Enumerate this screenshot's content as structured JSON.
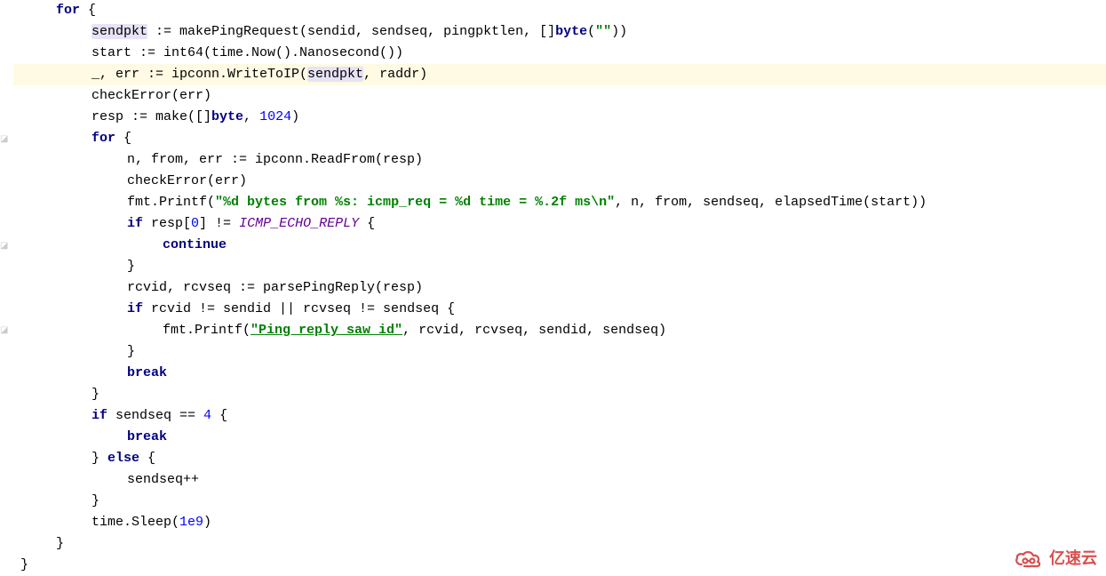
{
  "code": {
    "l1_for": "for",
    "l1_brace": " {",
    "l2_sendpkt": "sendpkt",
    "l2_assign": " := makePingRequest(sendid, sendseq, pingpktlen, []",
    "l2_byte": "byte",
    "l2_paren": "(",
    "l2_str": "\"\"",
    "l2_end": "))",
    "l3_a": "start := int64(time.Now().Nanosecond())",
    "l4_a": "_, err := ipconn.WriteToIP(",
    "l4_sendpkt": "sendpkt",
    "l4_b": ", raddr)",
    "l5": "checkError(err)",
    "l6_a": "resp := make([]",
    "l6_byte": "byte",
    "l6_b": ", ",
    "l6_num": "1024",
    "l6_c": ")",
    "l7_for": "for",
    "l7_brace": " {",
    "l8": "n, from, err := ipconn.ReadFrom(resp)",
    "l9": "checkError(err)",
    "l10_a": "fmt.Printf(",
    "l10_str": "\"%d bytes from %s: icmp_req = %d time = %.2f ms\\n\"",
    "l10_b": ", n, from, sendseq, elapsedTime(start))",
    "l11_if": "if",
    "l11_a": " resp[",
    "l11_num": "0",
    "l11_b": "] != ",
    "l11_const": "ICMP_ECHO_REPLY",
    "l11_c": " {",
    "l12": "continue",
    "l13": "}",
    "l14": "rcvid, rcvseq := parsePingReply(resp)",
    "l15_if": "if",
    "l15_a": " rcvid != sendid || rcvseq != sendseq {",
    "l16_a": "fmt.Printf(",
    "l16_str": "\"Ping reply saw id\"",
    "l16_b": ", rcvid, rcvseq, sendid, sendseq)",
    "l17": "}",
    "l18": "break",
    "l19": "}",
    "l20_if": "if",
    "l20_a": " sendseq == ",
    "l20_num": "4",
    "l20_b": " {",
    "l21": "break",
    "l22_a": "} ",
    "l22_else": "else",
    "l22_b": " {",
    "l23": "sendseq++",
    "l24": "}",
    "l25_a": "time.Sleep(",
    "l25_num": "1e9",
    "l25_b": ")",
    "l26": "}",
    "l27": "}"
  },
  "watermark": {
    "text": "亿速云"
  }
}
